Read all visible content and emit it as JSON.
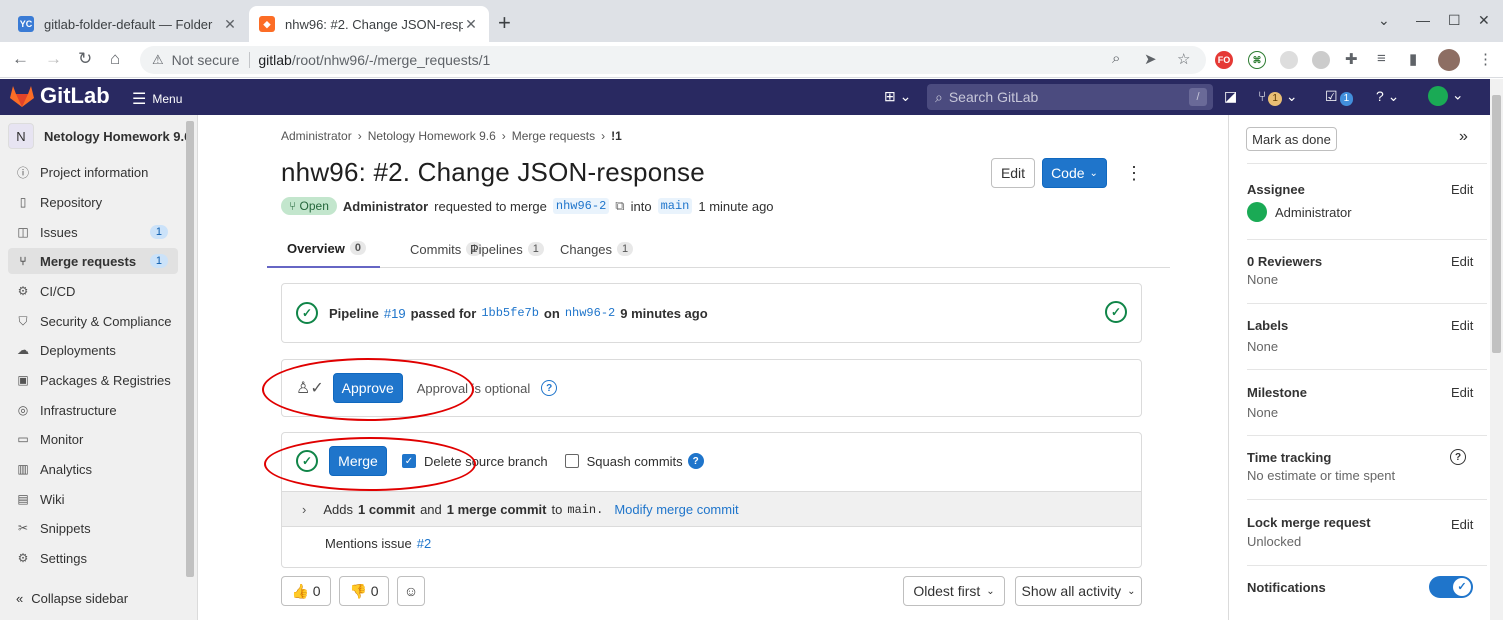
{
  "browser": {
    "tabs": [
      {
        "title": "gitlab-folder-default — Folder",
        "favicon": "YC"
      },
      {
        "title": "nhw96: #2. Change JSON-resp",
        "favicon": "gitlab-icon"
      }
    ],
    "address": {
      "security": "Not secure",
      "host": "gitlab",
      "path": "/root/nhw96/-/merge_requests/1"
    },
    "ext_label": "FO"
  },
  "header": {
    "logo_text": "GitLab",
    "menu_label": "Menu",
    "search_placeholder": "Search GitLab",
    "search_shortcut": "/",
    "mr_count": "1",
    "todo_count": "1"
  },
  "sidebar": {
    "project_initial": "N",
    "project_name": "Netology Homework 9.6",
    "items": [
      {
        "label": "Project information",
        "icon": "info-icon"
      },
      {
        "label": "Repository",
        "icon": "doc-icon"
      },
      {
        "label": "Issues",
        "icon": "issues-icon",
        "count": "1"
      },
      {
        "label": "Merge requests",
        "icon": "merge-icon",
        "count": "1"
      },
      {
        "label": "CI/CD",
        "icon": "rocket-icon"
      },
      {
        "label": "Security & Compliance",
        "icon": "shield-icon"
      },
      {
        "label": "Deployments",
        "icon": "cloud-icon"
      },
      {
        "label": "Packages & Registries",
        "icon": "package-icon"
      },
      {
        "label": "Infrastructure",
        "icon": "infra-icon"
      },
      {
        "label": "Monitor",
        "icon": "monitor-icon"
      },
      {
        "label": "Analytics",
        "icon": "chart-icon"
      },
      {
        "label": "Wiki",
        "icon": "book-icon"
      },
      {
        "label": "Snippets",
        "icon": "scissors-icon"
      },
      {
        "label": "Settings",
        "icon": "gear-icon"
      }
    ],
    "collapse_label": "Collapse sidebar"
  },
  "breadcrumb": [
    "Administrator",
    "Netology Homework 9.6",
    "Merge requests",
    "!1"
  ],
  "mr": {
    "title": "nhw96: #2. Change JSON-response",
    "edit_label": "Edit",
    "code_label": "Code",
    "status": "Open",
    "author": "Administrator",
    "requested_text": "requested to merge",
    "source_branch": "nhw96-2",
    "into_text": "into",
    "target_branch": "main",
    "time": "1 minute ago"
  },
  "tabs": [
    {
      "label": "Overview",
      "count": "0"
    },
    {
      "label": "Commits",
      "count": "1"
    },
    {
      "label": "Pipelines",
      "count": "1"
    },
    {
      "label": "Changes",
      "count": "1"
    }
  ],
  "pipeline": {
    "word": "Pipeline",
    "id": "#19",
    "passed_for": "passed for",
    "sha": "1bb5fe7b",
    "on": "on",
    "branch": "nhw96-2",
    "ago": "9 minutes ago"
  },
  "approval": {
    "button": "Approve",
    "text": "Approval is optional"
  },
  "merge": {
    "button": "Merge",
    "delete_branch": "Delete source branch",
    "squash": "Squash commits",
    "adds": "Adds",
    "commit_count": "1 commit",
    "and": "and",
    "merge_commit": "1 merge commit",
    "to": "to",
    "target": "main.",
    "modify": "Modify merge commit",
    "mentions": "Mentions issue",
    "issue": "#2"
  },
  "reactions": {
    "thumbs_up": "0",
    "thumbs_down": "0"
  },
  "sort": {
    "order": "Oldest first",
    "filter": "Show all activity"
  },
  "right_sidebar": {
    "mark_done": "Mark as done",
    "assignee_label": "Assignee",
    "assignee": "Administrator",
    "reviewers_label": "0 Reviewers",
    "reviewers": "None",
    "labels_label": "Labels",
    "labels": "None",
    "milestone_label": "Milestone",
    "milestone": "None",
    "time_label": "Time tracking",
    "time": "No estimate or time spent",
    "lock_label": "Lock merge request",
    "lock": "Unlocked",
    "notifications_label": "Notifications",
    "edit": "Edit"
  }
}
